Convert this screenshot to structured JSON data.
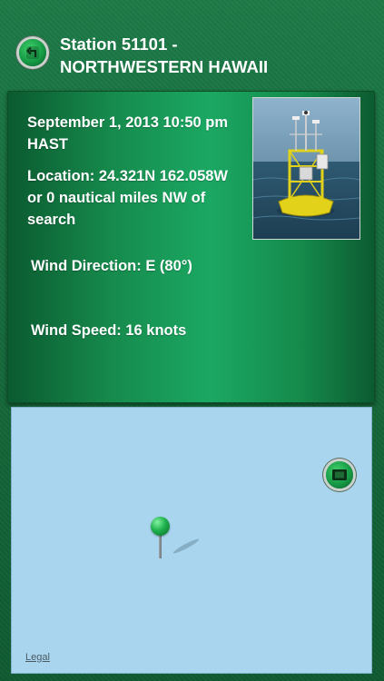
{
  "header": {
    "title_line1": "Station 51101 -",
    "title_line2": "NORTHWESTERN HAWAII"
  },
  "info": {
    "date": "September 1, 2013 10:50 pm HAST",
    "location": "Location: 24.321N 162.058W or 0 nautical miles NW of search",
    "wind_direction": "Wind Direction: E (80°)",
    "wind_speed": "Wind Speed: 16 knots"
  },
  "map": {
    "legal_label": "Legal"
  },
  "icons": {
    "back": "back-arrow-icon",
    "map_mode": "map-mode-icon",
    "pin": "map-pin-icon"
  },
  "colors": {
    "background": "#1d7a47",
    "panel": "#1ba863",
    "map_water": "#a9d6ee",
    "pin": "#1fb14e"
  }
}
